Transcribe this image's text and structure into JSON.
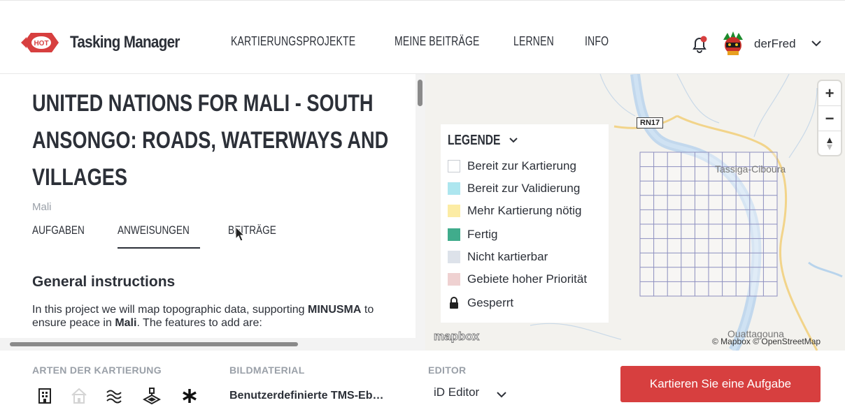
{
  "header": {
    "brand": "Tasking Manager",
    "logo_text": "HOT",
    "nav": [
      "KARTIERUNGSPROJEKTE",
      "MEINE BEITRÄGE",
      "LERNEN",
      "INFO"
    ],
    "username": "derFred"
  },
  "project": {
    "title_lines": [
      "UNITED NATIONS FOR MALI - SOUTH",
      "ANSONGO: ROADS, WATERWAYS AND",
      "VILLAGES"
    ],
    "country": "Mali",
    "tabs": [
      "AUFGABEN",
      "ANWEISUNGEN",
      "BEITRÄGE"
    ],
    "active_tab": "ANWEISUNGEN",
    "section_title": "General instructions",
    "instr_part1": "In this project we will map topographic data, supporting ",
    "instr_bold1": "MINUSMA",
    "instr_part2": " to ensure peace in ",
    "instr_bold2": "Mali",
    "instr_part3": ". The features to add are:"
  },
  "map": {
    "legend_title": "LEGENDE",
    "legend": [
      {
        "label": "Bereit zur Kartierung",
        "color": "#ffffff"
      },
      {
        "label": "Bereit zur Validierung",
        "color": "#ade6ef"
      },
      {
        "label": "Mehr Kartierung nötig",
        "color": "#fceca4"
      },
      {
        "label": "Fertig",
        "color": "#40ac8c"
      },
      {
        "label": "Nicht kartierbar",
        "color": "#dde2ea"
      },
      {
        "label": "Gebiete hoher Priorität",
        "color": "#efd1d1"
      },
      {
        "label": "Gesperrt",
        "color": "lock-icon"
      }
    ],
    "road_label": "RN17",
    "place_labels": [
      "Tassiga-Cibourа",
      "Ouattagouna"
    ],
    "zoom_in": "+",
    "zoom_out": "−",
    "mapbox_logo": "mapbox",
    "attribution": "© Mapbox © OpenStreetMap"
  },
  "footer": {
    "mapping_types_label": "ARTEN DER KARTIERUNG",
    "mapping_type_icons": [
      "building-icon",
      "house-icon",
      "waterway-icon",
      "landuse-icon",
      "other-icon"
    ],
    "imagery_label": "BILDMATERIAL",
    "imagery_value": "Benutzerdefinierte TMS-Eb…",
    "editor_label": "EDITOR",
    "editor_value": "iD Editor",
    "cta": "Kartieren Sie eine Aufgabe"
  },
  "colors": {
    "accent": "#d73f3f",
    "text": "#2c3038",
    "muted": "#9aa0a8"
  }
}
